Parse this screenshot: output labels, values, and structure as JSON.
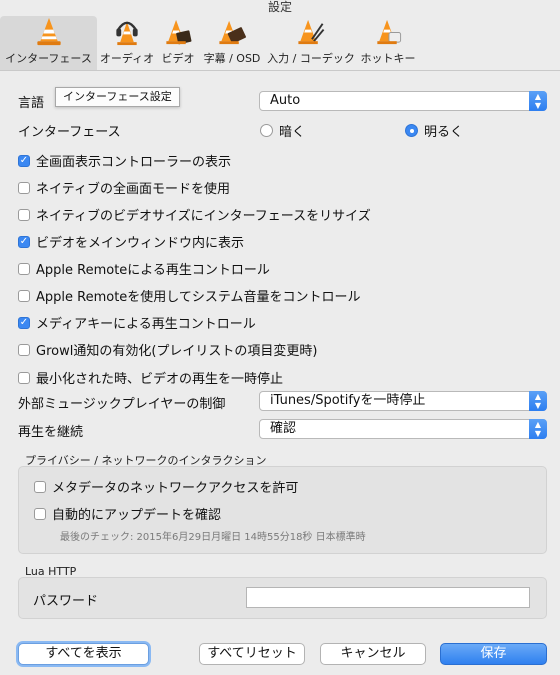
{
  "window": {
    "title": "設定"
  },
  "toolbar": {
    "tabs": [
      {
        "label": "インターフェース",
        "icon": "vlc-cone-icon"
      },
      {
        "label": "オーディオ",
        "icon": "vlc-headphones-icon"
      },
      {
        "label": "ビデオ",
        "icon": "vlc-film-icon"
      },
      {
        "label": "字幕 / OSD",
        "icon": "vlc-subtitle-icon"
      },
      {
        "label": "入力 / コーデック",
        "icon": "vlc-codec-icon"
      },
      {
        "label": "ホットキー",
        "icon": "vlc-hotkey-icon"
      }
    ],
    "active": "インターフェース"
  },
  "tooltip": {
    "text": "インターフェース設定"
  },
  "language": {
    "label": "言語",
    "value": "Auto"
  },
  "interface": {
    "label": "インターフェース",
    "option_dark": "暗く",
    "option_light": "明るく",
    "selected": "明るく"
  },
  "options": [
    {
      "label": "全画面表示コントローラーの表示",
      "checked": true
    },
    {
      "label": "ネイティブの全画面モードを使用",
      "checked": false
    },
    {
      "label": "ネイティブのビデオサイズにインターフェースをリサイズ",
      "checked": false
    },
    {
      "label": "ビデオをメインウィンドウ内に表示",
      "checked": true
    },
    {
      "label": "Apple Remoteによる再生コントロール",
      "checked": false
    },
    {
      "label": "Apple Remoteを使用してシステム音量をコントロール",
      "checked": false
    },
    {
      "label": "メディアキーによる再生コントロール",
      "checked": true
    },
    {
      "label": "Growl通知の有効化(プレイリストの項目変更時)",
      "checked": false
    },
    {
      "label": "最小化された時、ビデオの再生を一時停止",
      "checked": false
    }
  ],
  "external_player": {
    "label": "外部ミュージックプレイヤーの制御",
    "value": "iTunes/Spotifyを一時停止"
  },
  "resume": {
    "label": "再生を継続",
    "value": "確認"
  },
  "privacy": {
    "title": "プライバシー / ネットワークのインタラクション",
    "metadata_label": "メタデータのネットワークアクセスを許可",
    "metadata_checked": false,
    "update_label": "自動的にアップデートを確認",
    "update_checked": false,
    "last_check": "最後のチェック: 2015年6月29日月曜日 14時55分18秒 日本標準時"
  },
  "lua_http": {
    "title": "Lua HTTP",
    "password_label": "パスワード",
    "password_value": ""
  },
  "buttons": {
    "show_all": "すべてを表示",
    "reset_all": "すべてリセット",
    "cancel": "キャンセル",
    "save": "保存"
  },
  "colors": {
    "accent": "#3b88f2",
    "background": "#ececec"
  }
}
